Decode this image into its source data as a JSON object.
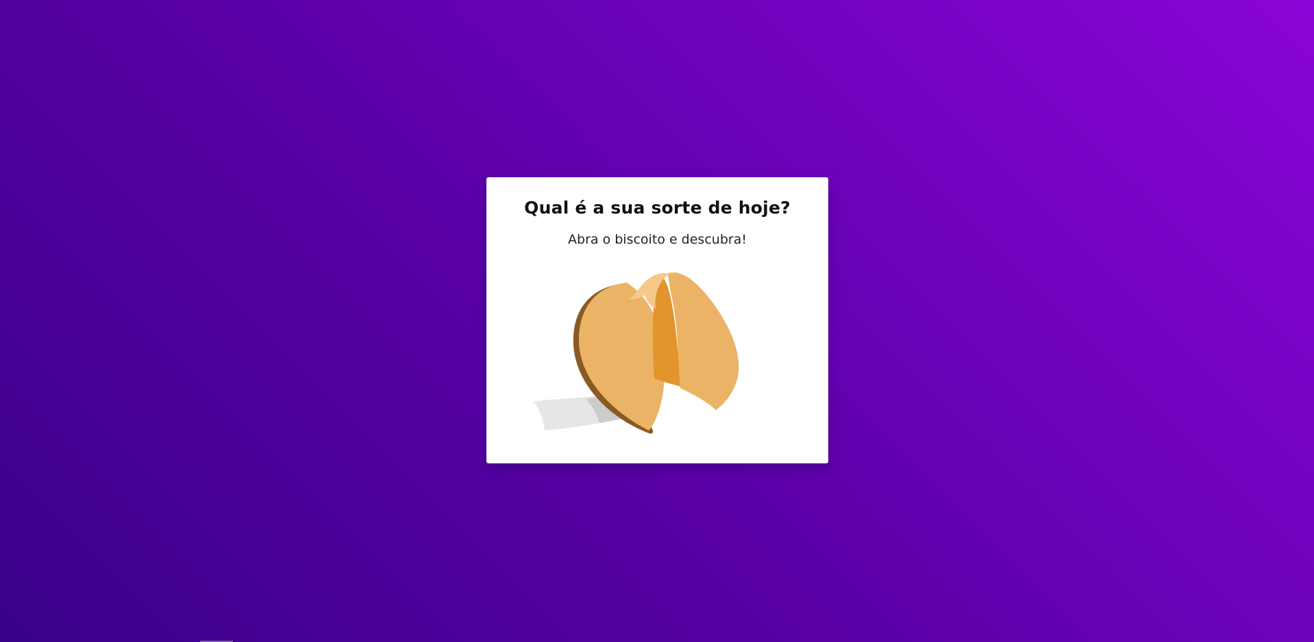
{
  "card": {
    "title": "Qual é a sua sorte de hoje?",
    "subtitle": "Abra o biscoito e descubra!"
  },
  "cookie": {
    "icon": "fortune-cookie-icon",
    "colors": {
      "dough": "#ebb365",
      "dough_light": "#f6c88a",
      "dough_inner": "#e3942c",
      "dough_shadow": "#8a5a24",
      "paper": "#e6e6e6",
      "paper_shadow": "#cccccc"
    }
  },
  "theme": {
    "background_start": "#3a0088",
    "background_end": "#8a05d6",
    "card_background": "#ffffff"
  }
}
